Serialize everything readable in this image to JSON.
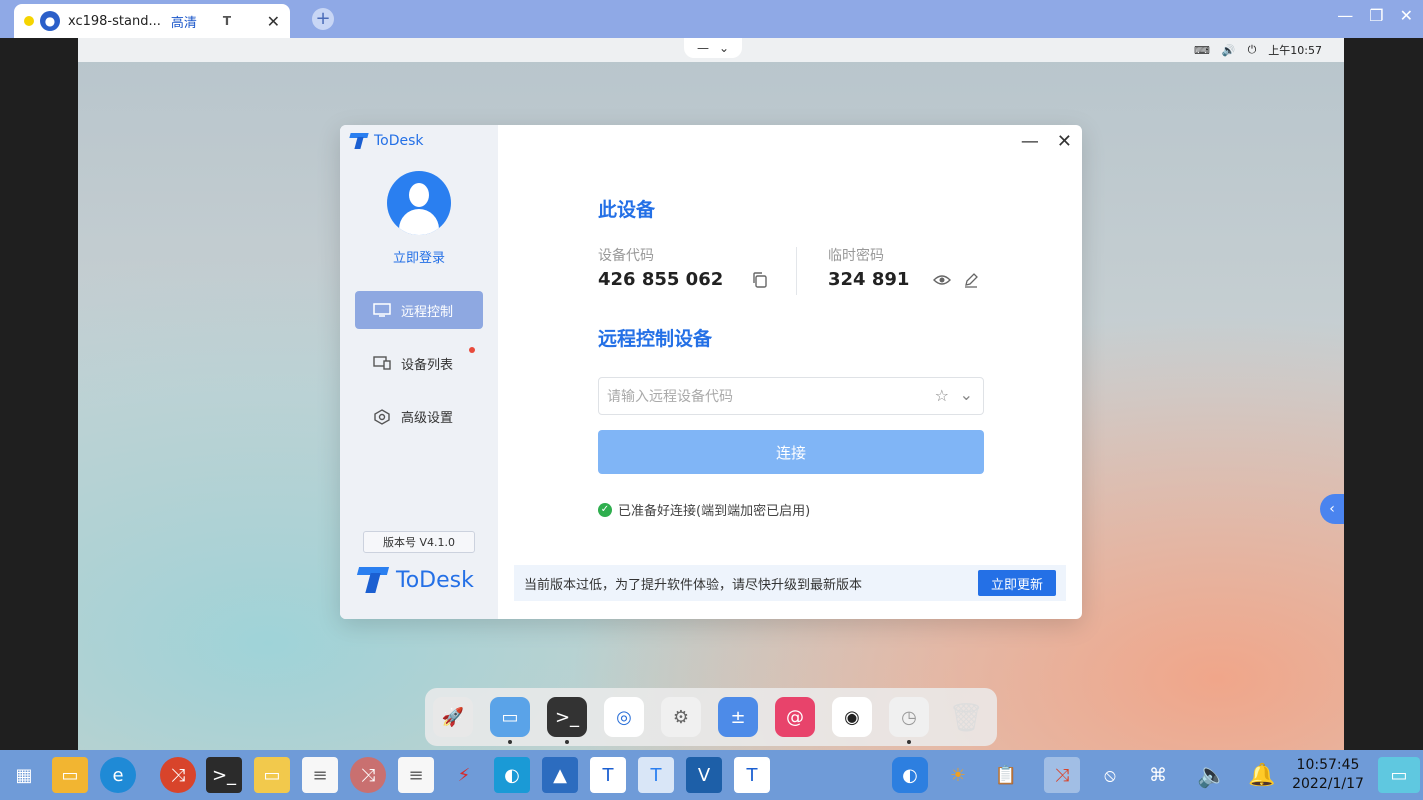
{
  "browser": {
    "tab_title": "xc198-stand...",
    "tab_quality": "高清",
    "tab_extra": "T",
    "favicon": "user-icon"
  },
  "remote_topbar": {
    "time": "上午10:57",
    "icons": [
      "keyboard-icon",
      "volume-icon",
      "power-icon"
    ]
  },
  "todesk": {
    "brand": "ToDesk",
    "login": "立即登录",
    "nav": [
      {
        "label": "远程控制",
        "active": true
      },
      {
        "label": "设备列表",
        "badge": true
      },
      {
        "label": "高级设置"
      }
    ],
    "version": "版本号 V4.1.0",
    "this_device": {
      "title": "此设备",
      "device_code_label": "设备代码",
      "device_code": "426 855 062",
      "temp_password_label": "临时密码",
      "temp_password": "324 891"
    },
    "remote": {
      "title": "远程控制设备",
      "placeholder": "请输入远程设备代码",
      "connect_label": "连接",
      "status": "已准备好连接(端到端加密已启用)"
    },
    "notice": {
      "text": "当前版本过低，为了提升软件体验，请尽快升级到最新版本",
      "button": "立即更新"
    }
  },
  "dock_items": [
    "launcher-icon",
    "files-icon",
    "terminal-icon",
    "browser-icon",
    "settings-icon",
    "calculator-icon",
    "debian-icon",
    "screenshot-icon",
    "system-monitor-icon",
    "trash-icon"
  ],
  "taskbar": {
    "time": "10:57:45",
    "date": "2022/1/17"
  },
  "colors": {
    "accent": "#2470e6",
    "sidebar_active": "#8ea8e1",
    "connect_button": "#80b5f6",
    "taskbar": "#6f9bd8",
    "tabbar": "#8fa9e6"
  }
}
